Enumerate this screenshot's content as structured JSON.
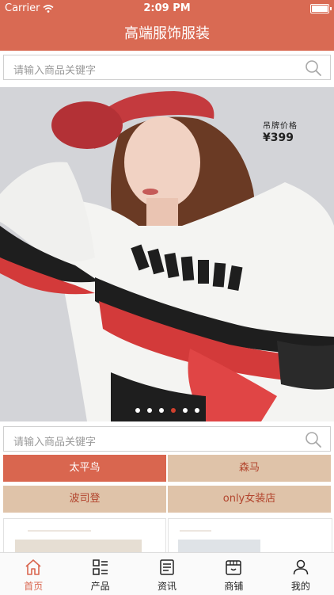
{
  "status": {
    "carrier": "Carrier",
    "time": "2:09 PM"
  },
  "header": {
    "title": "高端服饰服装"
  },
  "search_top": {
    "placeholder": "请输入商品关键字"
  },
  "search_mid": {
    "placeholder": "请输入商品关键字"
  },
  "banner": {
    "price_label": "吊牌价格",
    "price_value": "¥399",
    "slide_count": 6,
    "active_slide": 4
  },
  "categories": [
    {
      "label": "太平鸟"
    },
    {
      "label": "森马"
    },
    {
      "label": "波司登"
    },
    {
      "label": "only女装店"
    }
  ],
  "tabs": [
    {
      "label": "首页",
      "icon": "home-icon",
      "active": true
    },
    {
      "label": "产品",
      "icon": "grid-list-icon",
      "active": false
    },
    {
      "label": "资讯",
      "icon": "news-icon",
      "active": false
    },
    {
      "label": "商铺",
      "icon": "store-icon",
      "active": false
    },
    {
      "label": "我的",
      "icon": "user-icon",
      "active": false
    }
  ],
  "colors": {
    "brand": "#d96a53",
    "category_primary": "#d9664f",
    "category_secondary": "#dfc3a9",
    "slide_dot_active": "#d0402d"
  }
}
